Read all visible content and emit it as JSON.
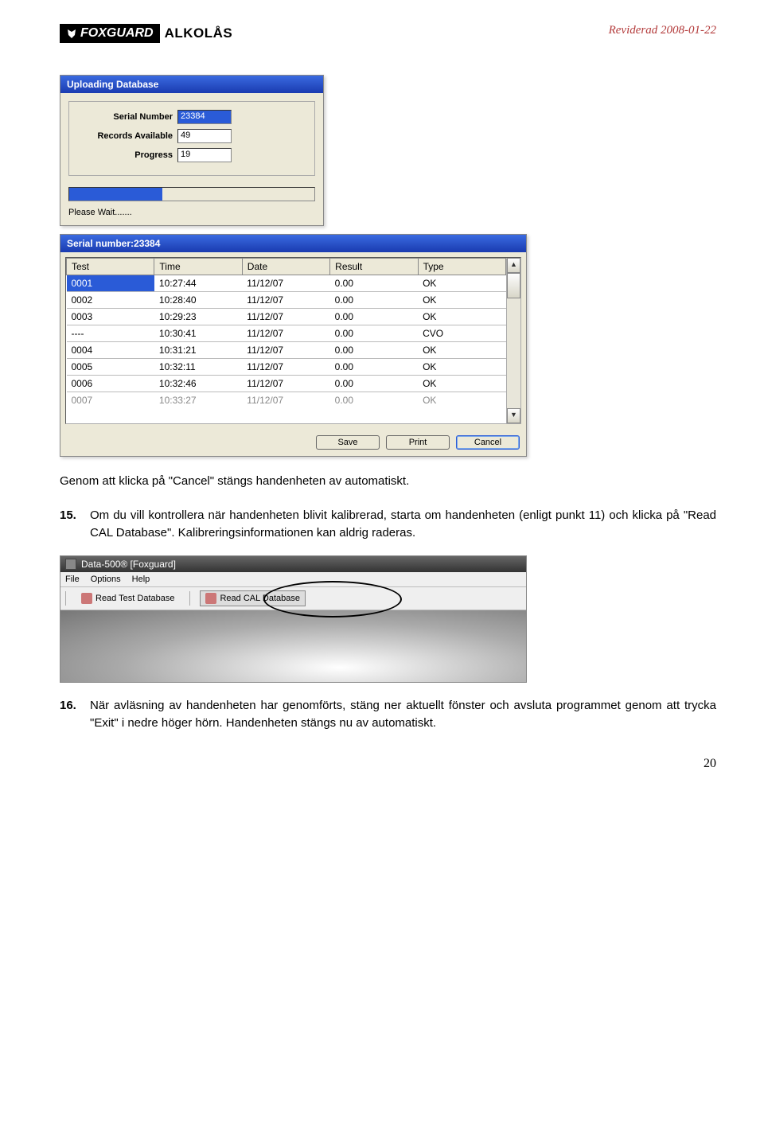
{
  "header": {
    "logo_brand": "FOXGUARD",
    "logo_sub": "ALKOLÅS",
    "revision": "Reviderad 2008-01-22"
  },
  "upload": {
    "title": "Uploading Database",
    "serial_label": "Serial Number",
    "serial_value": "23384",
    "records_label": "Records Available",
    "records_value": "49",
    "progress_label": "Progress",
    "progress_value": "19",
    "wait": "Please Wait......."
  },
  "results": {
    "title": "Serial number:23384",
    "cols": [
      "Test",
      "Time",
      "Date",
      "Result",
      "Type"
    ],
    "rows": [
      {
        "test": "0001",
        "time": "10:27:44",
        "date": "11/12/07",
        "result": "0.00",
        "type": "OK",
        "sel": true
      },
      {
        "test": "0002",
        "time": "10:28:40",
        "date": "11/12/07",
        "result": "0.00",
        "type": "OK"
      },
      {
        "test": "0003",
        "time": "10:29:23",
        "date": "11/12/07",
        "result": "0.00",
        "type": "OK"
      },
      {
        "test": "----",
        "time": "10:30:41",
        "date": "11/12/07",
        "result": "0.00",
        "type": "CVO"
      },
      {
        "test": "0004",
        "time": "10:31:21",
        "date": "11/12/07",
        "result": "0.00",
        "type": "OK"
      },
      {
        "test": "0005",
        "time": "10:32:11",
        "date": "11/12/07",
        "result": "0.00",
        "type": "OK"
      },
      {
        "test": "0006",
        "time": "10:32:46",
        "date": "11/12/07",
        "result": "0.00",
        "type": "OK"
      },
      {
        "test": "0007",
        "time": "10:33:27",
        "date": "11/12/07",
        "result": "0.00",
        "type": "OK",
        "cut": true
      }
    ],
    "buttons": {
      "save": "Save",
      "print": "Print",
      "cancel": "Cancel"
    }
  },
  "text": {
    "p1": "Genom att klicka på \"Cancel\" stängs handenheten av automatiskt.",
    "item15_num": "15.",
    "item15": "Om du vill kontrollera när handenheten blivit kalibrerad, starta om handenheten (enligt punkt 11) och klicka på \"Read CAL Database\". Kalibreringsinformationen kan aldrig raderas.",
    "item16_num": "16.",
    "item16": "När avläsning av handenheten har genomförts, stäng ner aktuellt fönster och avsluta programmet genom att trycka \"Exit\" i nedre höger hörn. Handenheten stängs nu av automatiskt.",
    "pagenum": "20"
  },
  "toolbar": {
    "title": "Data-500® [Foxguard]",
    "menu": [
      "File",
      "Options",
      "Help"
    ],
    "btn1": "Read Test Database",
    "btn2": "Read CAL Database"
  }
}
